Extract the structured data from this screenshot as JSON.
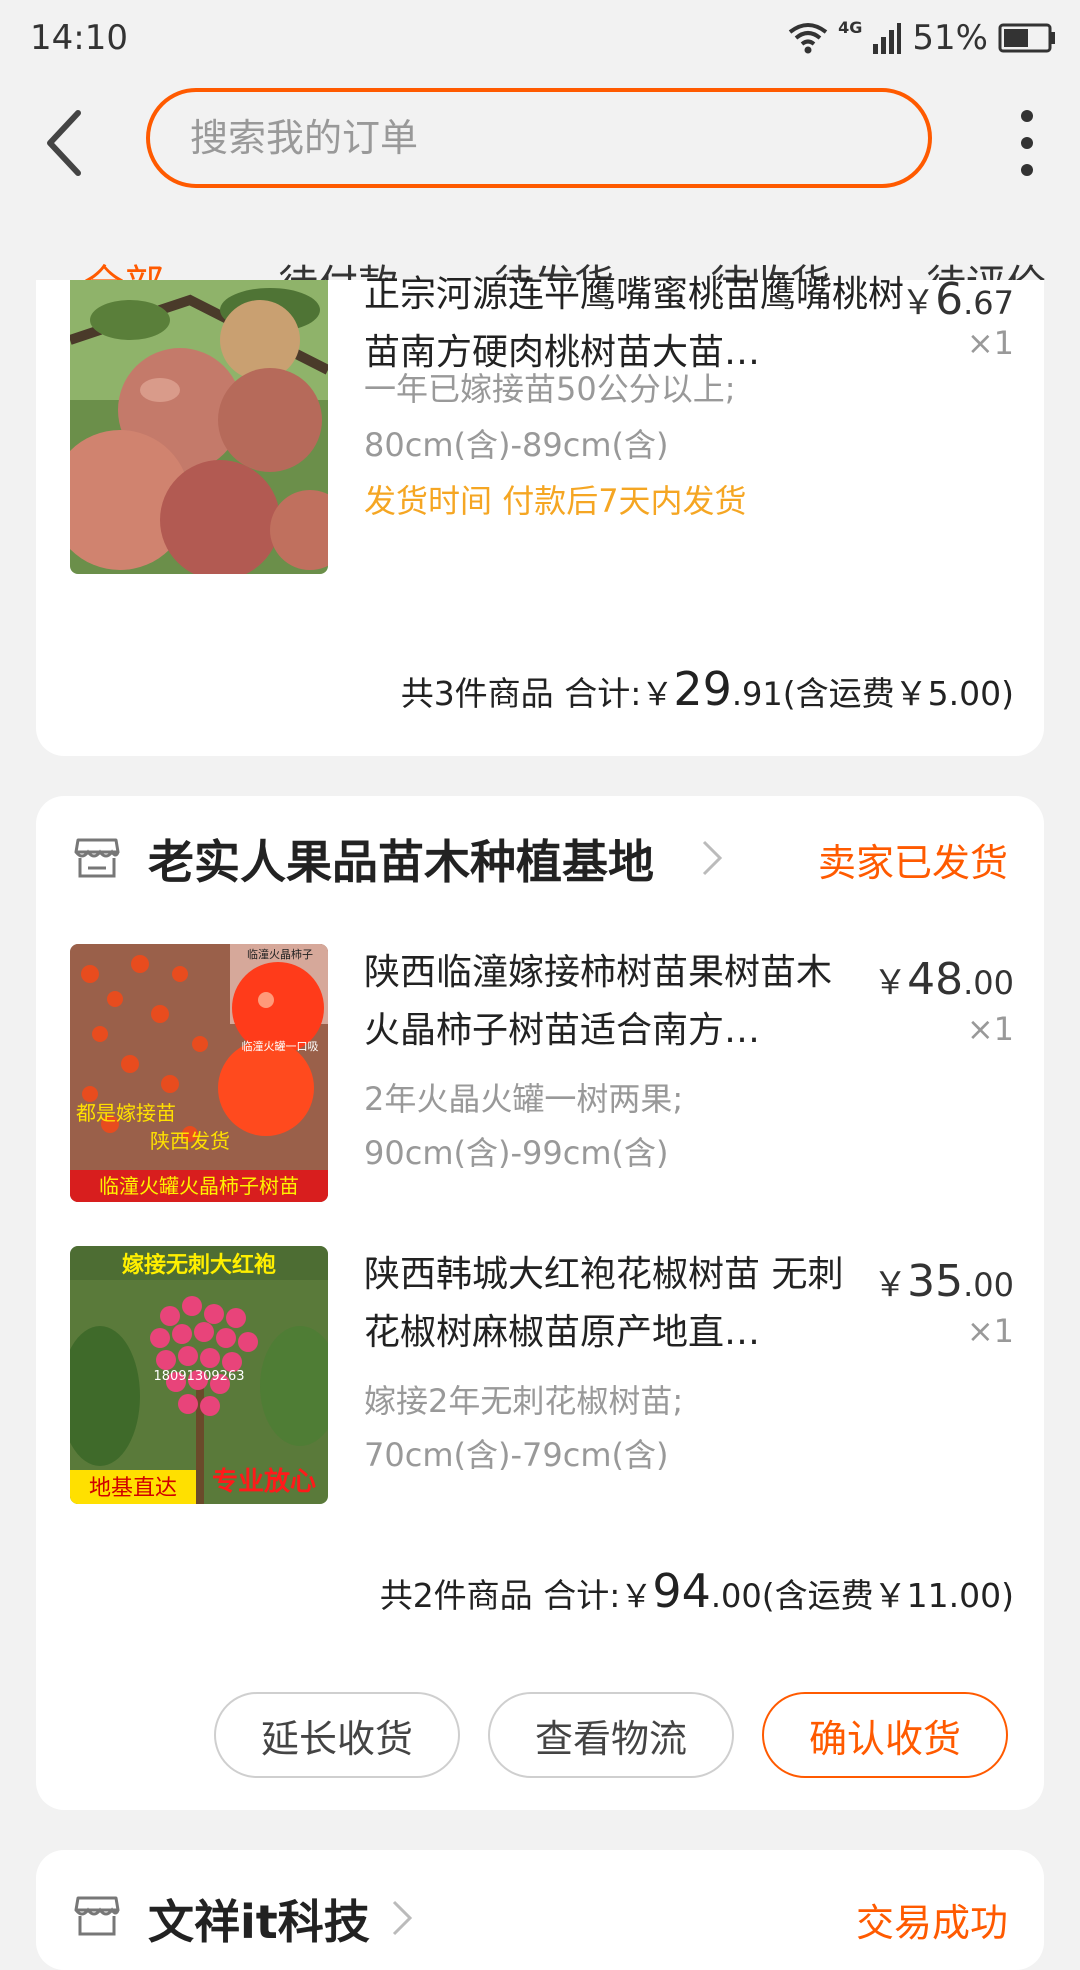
{
  "status_bar": {
    "time": "14:10",
    "network": "4G",
    "battery": "51%"
  },
  "header": {
    "search_placeholder": "搜索我的订单"
  },
  "tabs": [
    {
      "label": "全部",
      "active": true
    },
    {
      "label": "待付款"
    },
    {
      "label": "待发货"
    },
    {
      "label": "待收货"
    },
    {
      "label": "待评价"
    }
  ],
  "orders": [
    {
      "items": [
        {
          "title": "正宗河源连平鹰嘴蜜桃苗鹰嘴桃树苗南方硬肉桃树苗大苗…",
          "spec1": "一年已嫁接苗50公分以上;",
          "spec2": "80cm(含)-89cm(含)",
          "ship_label": "发货时间",
          "ship_value": "付款后7天内发货",
          "price_currency": "￥",
          "price_int": "6",
          "price_dec": ".67",
          "qty": "×1"
        }
      ],
      "total_count": "共3件商品",
      "total_label": "合计:",
      "total_currency": "￥",
      "total_int": "29",
      "total_dec": ".91",
      "shipping": "(含运费￥5.00)"
    },
    {
      "shop_name": "老实人果品苗木种植基地",
      "status": "卖家已发货",
      "items": [
        {
          "title": "陕西临潼嫁接柿树苗果树苗木火晶柿子树苗适合南方…",
          "spec1": "2年火晶火罐一树两果;",
          "spec2": "90cm(含)-99cm(含)",
          "price_currency": "￥",
          "price_int": "48",
          "price_dec": ".00",
          "qty": "×1",
          "image_text": {
            "top": "临潼火晶柿子",
            "mid1": "都是嫁接苗",
            "mid2": "陕西发货",
            "bottom": "临潼火罐火晶柿子树苗",
            "side": "临潼火罐一口吸"
          }
        },
        {
          "title": "陕西韩城大红袍花椒树苗 无刺花椒树麻椒苗原产地直…",
          "spec1": "嫁接2年无刺花椒树苗;",
          "spec2": "70cm(含)-79cm(含)",
          "price_currency": "￥",
          "price_int": "35",
          "price_dec": ".00",
          "qty": "×1",
          "image_text": {
            "top": "嫁接无刺大红袍",
            "phone": "18091309263",
            "bottom_left": "地基直达",
            "bottom_right": "专业放心"
          }
        }
      ],
      "total_count": "共2件商品",
      "total_label": "合计:",
      "total_currency": "￥",
      "total_int": "94",
      "total_dec": ".00",
      "shipping": "(含运费￥11.00)",
      "buttons": {
        "extend": "延长收货",
        "logistics": "查看物流",
        "confirm": "确认收货"
      }
    },
    {
      "shop_name": "文祥it科技",
      "status": "交易成功"
    }
  ],
  "colors": {
    "accent": "#ff5a00",
    "ship_text": "#f5a623",
    "background": "#f2f2f2"
  }
}
